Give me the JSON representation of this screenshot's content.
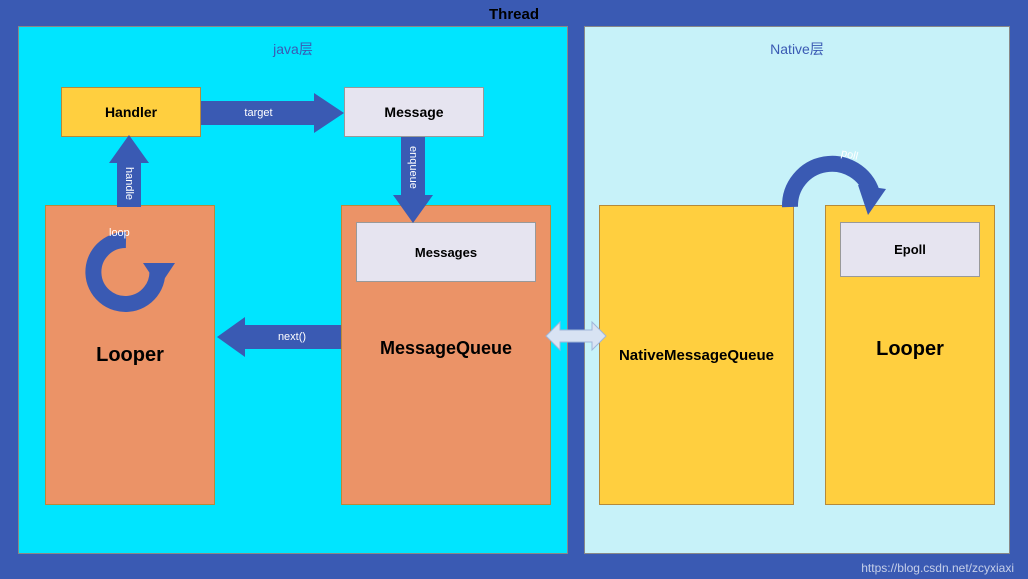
{
  "title": "Thread",
  "watermark": "https://blog.csdn.net/zcyxiaxi",
  "java": {
    "title": "java层",
    "handler": "Handler",
    "message": "Message",
    "looper": "Looper",
    "messageQueue": "MessageQueue",
    "messagesInner": "Messages",
    "arrows": {
      "target": "target",
      "enqueue": "enqueue",
      "handle": "handle",
      "next": "next()",
      "loop": "loop"
    }
  },
  "native": {
    "title": "Native层",
    "nativeMessageQueue": "NativeMessageQueue",
    "looper": "Looper",
    "epoll": "Epoll",
    "arrows": {
      "poll": "poll"
    }
  },
  "chart_data": {
    "type": "diagram",
    "title": "Thread",
    "nodes": [
      {
        "id": "java-layer",
        "label": "java层",
        "type": "container"
      },
      {
        "id": "native-layer",
        "label": "Native层",
        "type": "container"
      },
      {
        "id": "handler",
        "label": "Handler",
        "parent": "java-layer"
      },
      {
        "id": "message",
        "label": "Message",
        "parent": "java-layer"
      },
      {
        "id": "looper",
        "label": "Looper",
        "parent": "java-layer"
      },
      {
        "id": "message-queue",
        "label": "MessageQueue",
        "parent": "java-layer"
      },
      {
        "id": "messages",
        "label": "Messages",
        "parent": "message-queue"
      },
      {
        "id": "native-message-queue",
        "label": "NativeMessageQueue",
        "parent": "native-layer"
      },
      {
        "id": "native-looper",
        "label": "Looper",
        "parent": "native-layer"
      },
      {
        "id": "epoll",
        "label": "Epoll",
        "parent": "native-looper"
      }
    ],
    "edges": [
      {
        "from": "handler",
        "to": "message",
        "label": "target",
        "direction": "right"
      },
      {
        "from": "message",
        "to": "message-queue",
        "label": "enqueue",
        "direction": "down"
      },
      {
        "from": "looper",
        "to": "handler",
        "label": "handle",
        "direction": "up"
      },
      {
        "from": "message-queue",
        "to": "looper",
        "label": "next()",
        "direction": "left"
      },
      {
        "from": "looper",
        "to": "looper",
        "label": "loop",
        "type": "self"
      },
      {
        "from": "message-queue",
        "to": "native-message-queue",
        "label": "",
        "direction": "bidirectional"
      },
      {
        "from": "native-message-queue",
        "to": "native-looper",
        "label": "poll",
        "type": "curved"
      }
    ]
  }
}
